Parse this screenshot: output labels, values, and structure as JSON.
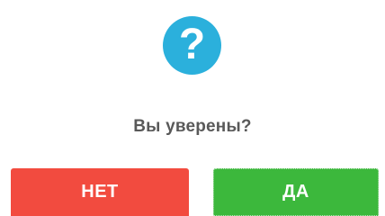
{
  "dialog": {
    "icon": "question-icon",
    "icon_glyph": "?",
    "icon_color": "#2bb0dc",
    "title": "Вы уверены?",
    "buttons": {
      "no_label": "НЕТ",
      "yes_label": "ДА",
      "no_color": "#f24b3f",
      "yes_color": "#3cb83c"
    }
  }
}
